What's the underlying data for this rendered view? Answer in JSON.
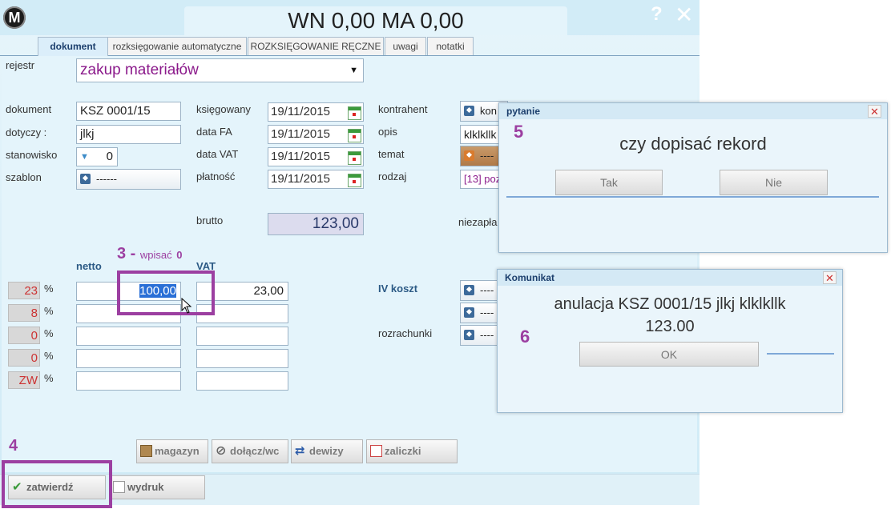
{
  "window": {
    "title": "WN 0,00 MA 0,00",
    "logo_letter": "M",
    "help": "?",
    "close": "✕"
  },
  "tabs": [
    "dokument",
    "rozksięgowanie automatyczne",
    "ROZKSIĘGOWANIE RĘCZNE",
    "uwagi",
    "notatki"
  ],
  "form": {
    "rejestr_label": "rejestr",
    "rejestr_value": "zakup materiałów",
    "dokument_label": "dokument",
    "dokument_value": "KSZ 0001/15",
    "dotyczy_label": "dotyczy :",
    "dotyczy_value": "jlkj",
    "stanowisko_label": "stanowisko",
    "stanowisko_value": "0",
    "szablon_label": "szablon",
    "szablon_value": "------",
    "ksiegowany_label": "księgowany",
    "ksiegowany_value": "19/11/2015",
    "datafa_label": "data FA",
    "datafa_value": "19/11/2015",
    "datavat_label": "data VAT",
    "datavat_value": "19/11/2015",
    "platnosc_label": "płatność",
    "platnosc_value": "19/11/2015",
    "kontrahent_label": "kontrahent",
    "kontrahent_value": "kon",
    "opis_label": "opis",
    "opis_value": "klklkllk",
    "temat_label": "temat",
    "temat_value": "----",
    "rodzaj_label": "rodzaj",
    "rodzaj_value": "[13] poz",
    "brutto_label": "brutto",
    "brutto_value": "123,00",
    "niezaplacone_label": "niezapła",
    "netto_label": "netto",
    "vat_label": "VAT",
    "iv_koszt_label": "IV koszt",
    "iv_koszt_pickers": [
      "----",
      "----"
    ],
    "rozrachunki_label": "rozrachunki",
    "rozrachunki_value": "----",
    "rates": [
      {
        "rate": "23",
        "pct": "%",
        "netto": "100,00",
        "vat": "23,00"
      },
      {
        "rate": "8",
        "pct": "%",
        "netto": "",
        "vat": ""
      },
      {
        "rate": "0",
        "pct": "%",
        "netto": "",
        "vat": ""
      },
      {
        "rate": "0",
        "pct": "%",
        "netto": "",
        "vat": ""
      },
      {
        "rate": "ZW",
        "pct": "%",
        "netto": "",
        "vat": ""
      }
    ]
  },
  "buttons": {
    "magazyn": "magazyn",
    "dolacz": "dołącz/wc",
    "dewizy": "dewizy",
    "zaliczki": "zaliczki",
    "zatwierdz": "zatwierdź",
    "wydruk": "wydruk"
  },
  "dialog_pytanie": {
    "title": "pytanie",
    "close": "✕",
    "message": "czy dopisać rekord",
    "yes": "Tak",
    "no": "Nie"
  },
  "dialog_komunikat": {
    "title": "Komunikat",
    "close": "✕",
    "line1": "anulacja KSZ 0001/15 jlkj klklkllk",
    "line2": "123.00",
    "ok": "OK"
  },
  "annotations": {
    "step3_num": "3 -",
    "step3_text": "wpisać",
    "step3_zero": "0",
    "step4": "4",
    "step5": "5",
    "step6": "6"
  },
  "colors": {
    "annotation": "#9c3fa1",
    "title_bg": "#d2ecf7",
    "content_bg": "#e4f4fb",
    "accent_blue": "#2c5a85"
  }
}
